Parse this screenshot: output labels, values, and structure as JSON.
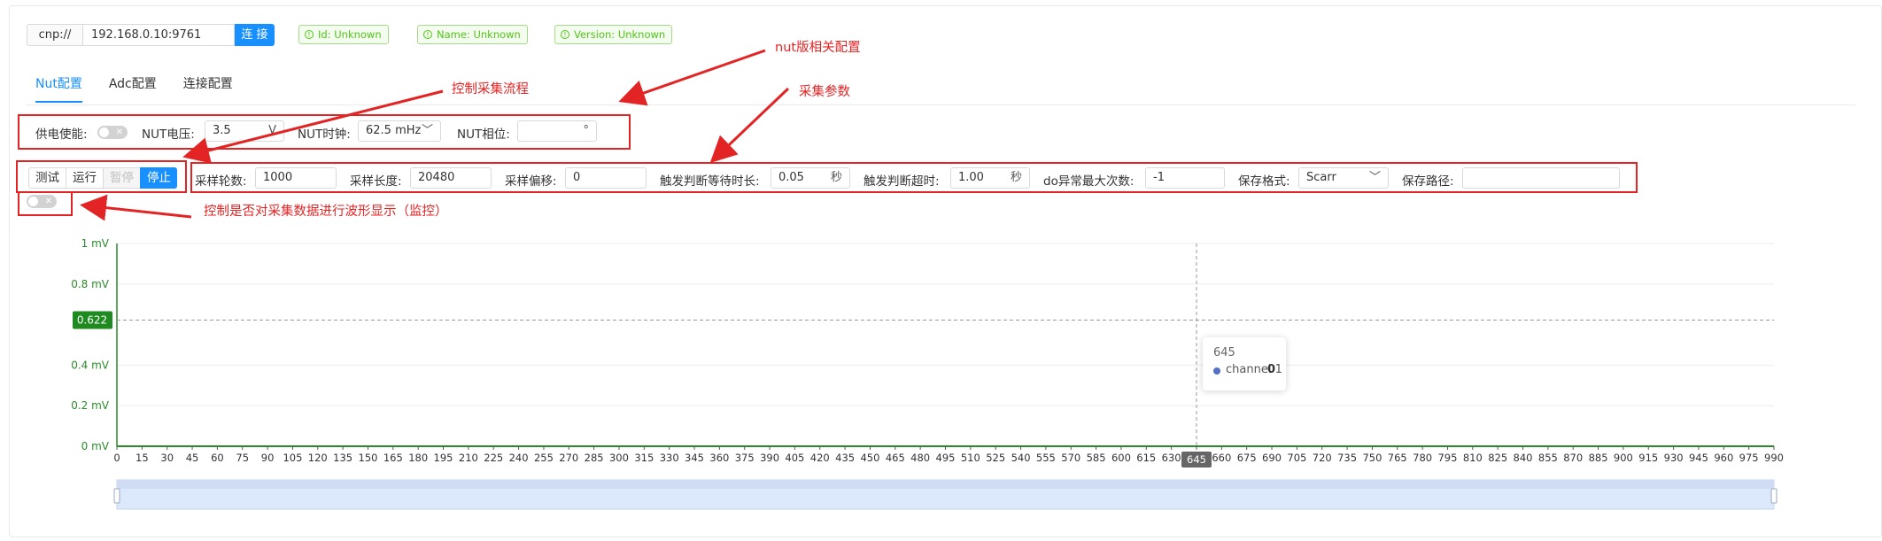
{
  "connection": {
    "scheme": "cnp://",
    "address": "192.168.0.10:9761",
    "connect_label": "连 接"
  },
  "info_tags": [
    "Id: Unknown",
    "Name: Unknown",
    "Version: Unknown"
  ],
  "tabs": [
    {
      "label": "Nut配置",
      "active": true
    },
    {
      "label": "Adc配置",
      "active": false
    },
    {
      "label": "连接配置",
      "active": false
    }
  ],
  "nut": {
    "power_enable_label": "供电使能:",
    "voltage_label": "NUT电压:",
    "voltage_value": "3.5",
    "voltage_unit": "V",
    "clock_label": "NUT时钟:",
    "clock_value": "62.5 mHz",
    "phase_label": "NUT相位:",
    "phase_value": "",
    "phase_unit": "°"
  },
  "controls": {
    "test": "测试",
    "run": "运行",
    "pause": "暂停",
    "stop": "停止"
  },
  "params": {
    "rounds_label": "采样轮数:",
    "rounds_value": "1000",
    "length_label": "采样长度:",
    "length_value": "20480",
    "offset_label": "采样偏移:",
    "offset_value": "0",
    "wait_label": "触发判断等待时长:",
    "wait_value": "0.05",
    "wait_unit": "秒",
    "timeout_label": "触发判断超时:",
    "timeout_value": "1.00",
    "timeout_unit": "秒",
    "maxerr_label": "do异常最大次数:",
    "maxerr_value": "-1",
    "format_label": "保存格式:",
    "format_value": "Scarr",
    "path_label": "保存路径:",
    "path_value": ""
  },
  "annotations": {
    "nut_config": "nut版相关配置",
    "flow_control": "控制采集流程",
    "params": "采集参数",
    "monitor": "控制是否对采集数据进行波形显示（监控）"
  },
  "chart_data": {
    "type": "line",
    "series": [
      {
        "name": "channel 1",
        "x": [
          0,
          990
        ],
        "values": [
          0,
          0
        ]
      }
    ],
    "ylim": [
      0,
      1
    ],
    "y_ticks": [
      "1 mV",
      "0.8 mV",
      "0.622",
      "0.4 mV",
      "0.2 mV",
      "0 mV"
    ],
    "y_tick_values": [
      1,
      0.8,
      0.622,
      0.4,
      0.2,
      0
    ],
    "x_start": 0,
    "x_step": 15,
    "x_count": 67,
    "cursor": {
      "x": 645,
      "y": 0.622,
      "x_label": "645",
      "y_label": "0.622"
    },
    "tooltip": {
      "title": "645",
      "series": "channel 1",
      "value": "0"
    },
    "colors": {
      "axis": "#2a8a2a",
      "series": "#5470c6",
      "zoom": "#dce8fb"
    }
  }
}
